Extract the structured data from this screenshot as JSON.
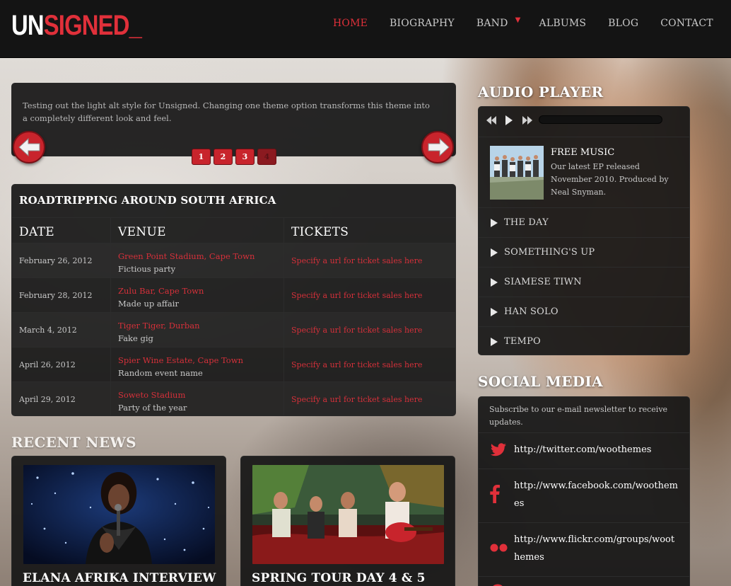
{
  "header": {
    "logo_white": "UN",
    "logo_red": "SIGNED_",
    "nav": [
      {
        "label": "HOME",
        "active": true
      },
      {
        "label": "BIOGRAPHY"
      },
      {
        "label": "BAND",
        "has_dropdown": true
      },
      {
        "label": "ALBUMS"
      },
      {
        "label": "BLOG"
      },
      {
        "label": "CONTACT"
      }
    ]
  },
  "slider": {
    "text": "Testing out the light alt style for Unsigned. Changing one theme option transforms this theme into a completely different look and feel.",
    "prev_icon": "arrow-left-icon",
    "next_icon": "arrow-right-icon",
    "pages": [
      "1",
      "2",
      "3",
      "4"
    ],
    "current_page": 4
  },
  "tour": {
    "title": "ROADTRIPPING AROUND SOUTH AFRICA",
    "columns": [
      "DATE",
      "VENUE",
      "TICKETS"
    ],
    "rows": [
      {
        "date": "February 26, 2012",
        "venue": "Green Point Stadium, Cape Town",
        "event": "Fictious party",
        "ticket": "Specify a url for ticket sales here"
      },
      {
        "date": "February 28, 2012",
        "venue": "Zulu Bar, Cape Town",
        "event": "Made up affair",
        "ticket": "Specify a url for ticket sales here"
      },
      {
        "date": "March 4, 2012",
        "venue": "Tiger Tiger, Durban",
        "event": "Fake gig",
        "ticket": "Specify a url for ticket sales here"
      },
      {
        "date": "April 26, 2012",
        "venue": "Spier Wine Estate, Cape Town",
        "event": "Random event name",
        "ticket": "Specify a url for ticket sales here"
      },
      {
        "date": "April 29, 2012",
        "venue": "Soweto Stadium",
        "event": "Party of the year",
        "ticket": "Specify a url for ticket sales here"
      }
    ]
  },
  "recent_news": {
    "heading": "RECENT NEWS",
    "items": [
      {
        "title": "ELANA AFRIKA INTERVIEW"
      },
      {
        "title": "SPRING TOUR DAY 4 & 5"
      }
    ]
  },
  "audio_player": {
    "heading": "AUDIO PLAYER",
    "featured": {
      "title": "FREE MUSIC",
      "description": "Our latest EP released November 2010. Produced by Neal Snyman."
    },
    "tracks": [
      "THE DAY",
      "SOMETHING'S UP",
      "SIAMESE TIWN",
      "HAN SOLO",
      "TEMPO"
    ]
  },
  "social_media": {
    "heading": "SOCIAL MEDIA",
    "intro": "Subscribe to our e-mail newsletter to receive updates.",
    "links": [
      {
        "icon": "twitter-icon",
        "url": "http://twitter.com/woothemes"
      },
      {
        "icon": "facebook-icon",
        "url": "http://www.facebook.com/woothemes"
      },
      {
        "icon": "flickr-icon",
        "url": "http://www.flickr.com/groups/woothemes"
      }
    ]
  },
  "colors": {
    "accent": "#e0303a",
    "panel": "#161616",
    "header": "#141414"
  }
}
